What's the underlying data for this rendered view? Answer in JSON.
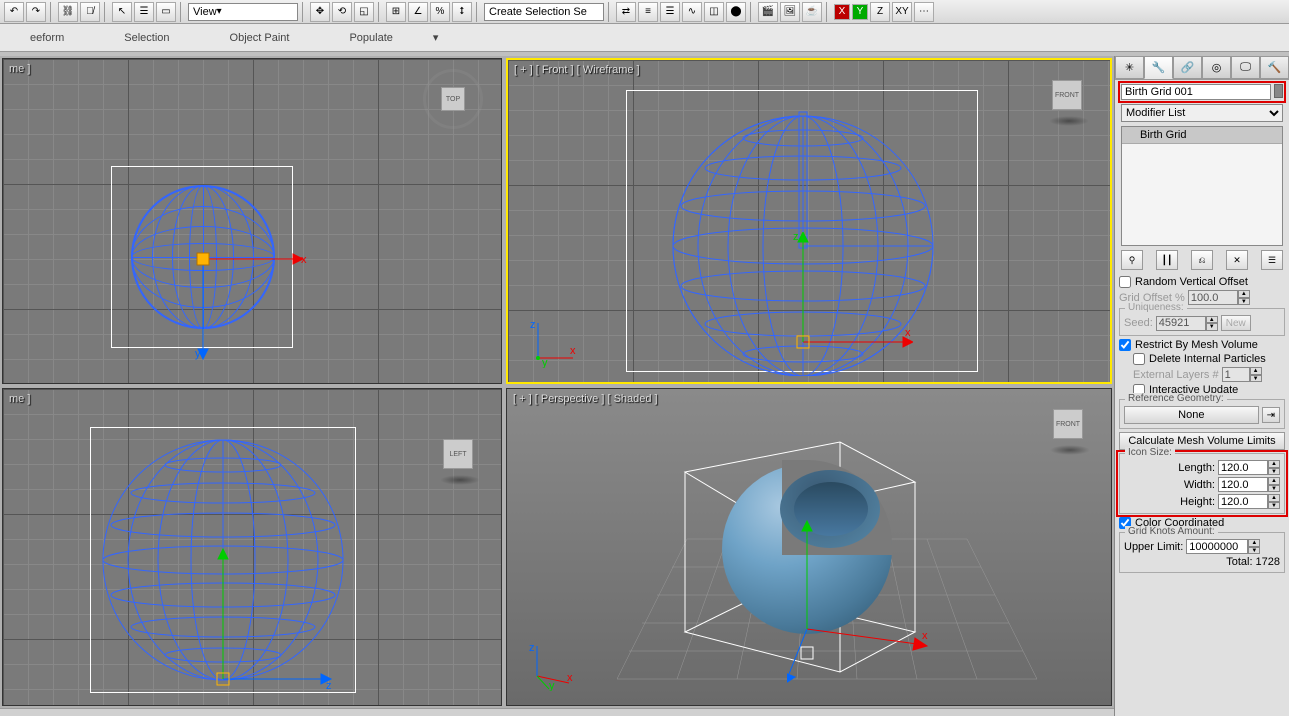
{
  "toolbar": {
    "view_dropdown": "View",
    "selection_set": "Create Selection Se",
    "axes": {
      "x": "X",
      "y": "Y",
      "z": "Z",
      "xy": "XY"
    }
  },
  "ribbon": {
    "tabs": [
      "eeform",
      "Selection",
      "Object Paint",
      "Populate"
    ]
  },
  "viewports": {
    "top": {
      "label": "me ]"
    },
    "front": {
      "label": "[ + ] [ Front ] [ Wireframe ]",
      "cube_face": "FRONT"
    },
    "left": {
      "label": "me ]",
      "cube_face": "LEFT"
    },
    "persp": {
      "label": "[ + ] [ Perspective ] [ Shaded ]",
      "cube_face": "FRONT"
    },
    "top_cube": "TOP"
  },
  "panel": {
    "object_name": "Birth Grid 001",
    "modifier_list": "Modifier List",
    "mod_stack_item": "Birth Grid",
    "random_offset": "Random Vertical Offset",
    "grid_offset_lbl": "Grid Offset %",
    "grid_offset_val": "100.0",
    "uniqueness_group": "Uniqueness:",
    "seed_lbl": "Seed:",
    "seed_val": "45921",
    "new_btn": "New",
    "restrict_mesh": "Restrict By Mesh Volume",
    "delete_internal": "Delete Internal Particles",
    "external_layers_lbl": "External Layers #",
    "external_layers_val": "1",
    "interactive_update": "Interactive Update",
    "ref_geom_group": "Reference Geometry:",
    "ref_geom_btn": "None",
    "calc_limits_btn": "Calculate Mesh Volume Limits",
    "icon_size_group": "Icon Size:",
    "length_lbl": "Length:",
    "length_val": "120.0",
    "width_lbl": "Width:",
    "width_val": "120.0",
    "height_lbl": "Height:",
    "height_val": "120.0",
    "color_coord": "Color Coordinated",
    "grid_knots_group": "Grid Knots Amount:",
    "upper_limit_lbl": "Upper Limit:",
    "upper_limit_val": "10000000",
    "total_lbl": "Total:",
    "total_val": "1728"
  }
}
